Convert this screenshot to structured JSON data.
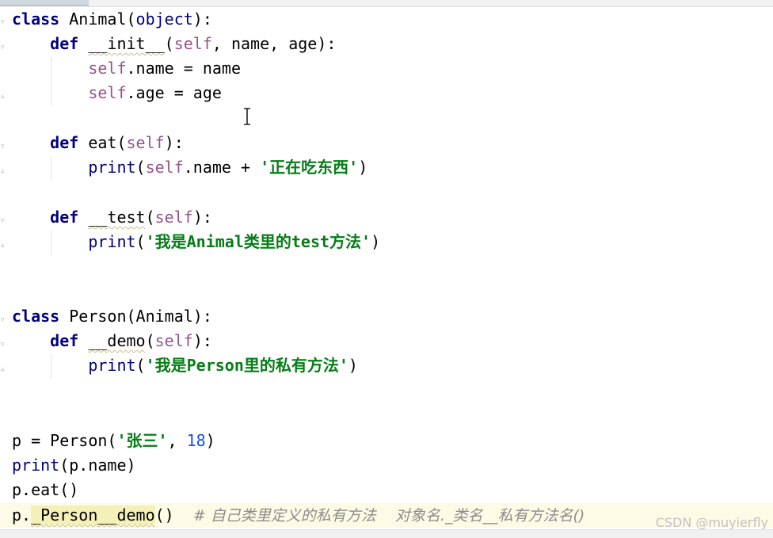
{
  "editor": {
    "lines": {
      "l1": {
        "kw": "class",
        "name": " Animal(",
        "param": "object",
        "end": "):"
      },
      "l2": {
        "kw": "def",
        "sp": " ",
        "name": "__init__",
        "open": "(",
        "self": "self",
        "rest": ", name, age):"
      },
      "l3": {
        "self": "self",
        "rest": ".name = name"
      },
      "l4": {
        "self": "self",
        "rest": ".age = age"
      },
      "l6": {
        "kw": "def",
        "name": " eat(",
        "self": "self",
        "end": "):"
      },
      "l7": {
        "bi": "print",
        "open": "(",
        "self": "self",
        "mid": ".name + ",
        "str": "'正在吃东西'",
        "end": ")"
      },
      "l9": {
        "kw": "def",
        "sp": " ",
        "name": "__test",
        "open": "(",
        "self": "self",
        "end": "):"
      },
      "l10": {
        "bi": "print",
        "open": "(",
        "str": "'我是Animal类里的test方法'",
        "end": ")"
      },
      "l13": {
        "kw": "class",
        "name": " Person(Animal):"
      },
      "l14": {
        "kw": "def",
        "sp": " ",
        "name": "__demo",
        "open": "(",
        "self": "self",
        "end": "):"
      },
      "l15": {
        "bi": "print",
        "open": "(",
        "str": "'我是Person里的私有方法'",
        "end": ")"
      },
      "l18": {
        "pre": "p = Person(",
        "str": "'张三'",
        "mid": ", ",
        "num": "18",
        "end": ")"
      },
      "l19": {
        "bi": "print",
        "rest": "(p.name)"
      },
      "l20": {
        "rest": "p.eat()"
      },
      "l21": {
        "pre": "p.",
        "method": "_Person__demo",
        "end": "()  ",
        "cmt": "# 自己类里定义的私有方法    对象名._类名__私有方法名()"
      }
    }
  },
  "watermark": "CSDN @muyierfly",
  "colors": {
    "keyword": "#000080",
    "self": "#94558d",
    "string": "#067d17",
    "number": "#1750eb",
    "comment": "#8c8c8c",
    "current_line": "#fdfbe5"
  }
}
